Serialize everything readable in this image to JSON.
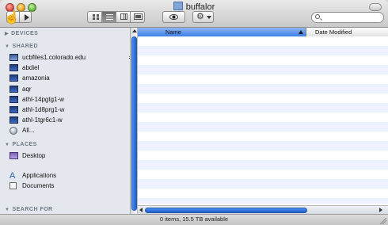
{
  "window": {
    "title": "buffalor"
  },
  "toolbar": {
    "search_placeholder": ""
  },
  "sidebar": {
    "sections": {
      "devices": "DEVICES",
      "shared": "SHARED",
      "places": "PLACES",
      "search_for": "SEARCH FOR"
    },
    "shared_items": [
      "ucbfiles1.colorado.edu",
      "abdiel",
      "amazonia",
      "aqr",
      "athl-14pgtg1-w",
      "athl-1d8prg1-w",
      "athl-1tgr6c1-w",
      "All..."
    ],
    "places_items": [
      "Desktop",
      "Applications",
      "Documents"
    ]
  },
  "list": {
    "columns": {
      "name": "Name",
      "date": "Date Modified"
    }
  },
  "status": {
    "text": "0 items, 15.5 TB available"
  },
  "colors": {
    "accent": "#3c7fe6",
    "sidebar_bg": "#e4e8ee",
    "row_alt": "#edf3fe"
  },
  "icons": {
    "cursor": "hand-cursor-icon",
    "folder": "folder-icon",
    "eject": "eject-icon",
    "eye": "eye-icon",
    "gear": "gear-icon",
    "search": "search-icon"
  }
}
